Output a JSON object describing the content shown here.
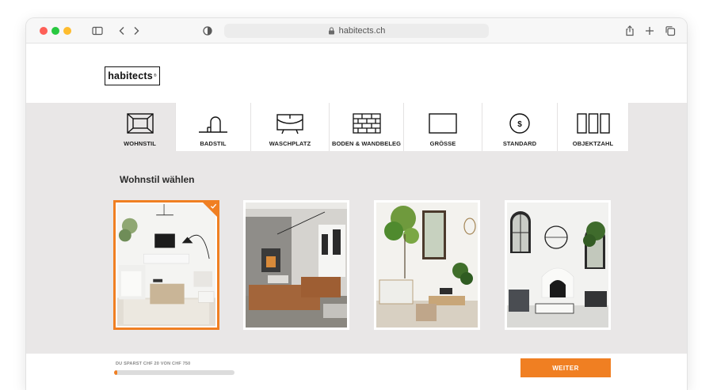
{
  "browser": {
    "url": "habitects.ch"
  },
  "site": {
    "logo": "habitects",
    "logo_mark": "®"
  },
  "nav": {
    "items": [
      {
        "label": "WOHNSTIL",
        "icon": "room-icon",
        "active": true
      },
      {
        "label": "BADSTIL",
        "icon": "faucet-icon",
        "active": false
      },
      {
        "label": "WASCHPLATZ",
        "icon": "washbasin-icon",
        "active": false
      },
      {
        "label": "BODEN & WANDBELEG",
        "icon": "tiles-icon",
        "active": false
      },
      {
        "label": "GRÖSSE",
        "icon": "size-icon",
        "active": false
      },
      {
        "label": "STANDARD",
        "icon": "dollar-icon",
        "active": false
      },
      {
        "label": "OBJEKTZAHL",
        "icon": "objects-icon",
        "active": false
      }
    ]
  },
  "main": {
    "title": "Wohnstil wählen",
    "styles": [
      {
        "name": "style-modern-white",
        "selected": true
      },
      {
        "name": "style-industrial",
        "selected": false
      },
      {
        "name": "style-natural-plants",
        "selected": false
      },
      {
        "name": "style-mediterranean-white",
        "selected": false
      }
    ]
  },
  "footer": {
    "savings_text": "DU SPARST CHF 20 VON CHF 750",
    "progress_fraction": 0.027,
    "next_label": "WEITER"
  },
  "colors": {
    "accent": "#f07f22",
    "nav_bg": "#e9e7e7"
  }
}
